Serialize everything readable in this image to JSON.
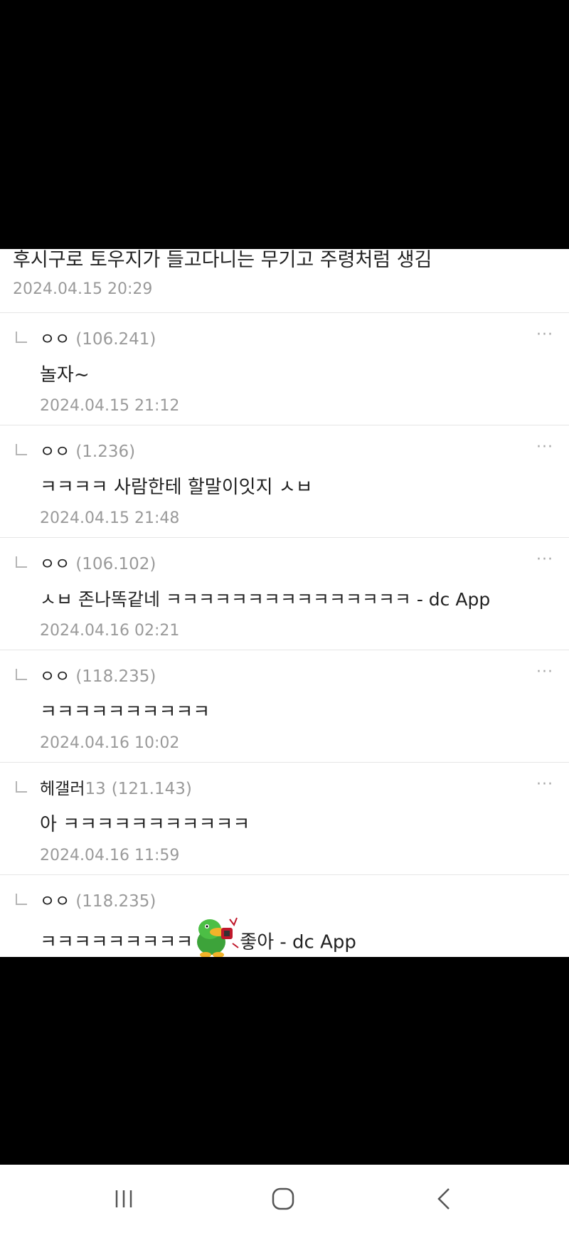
{
  "parent": {
    "text": "후시구로 토우지가 들고다니는 무기고 주령처럼 생김",
    "date": "2024.04.15 20:29"
  },
  "replies": [
    {
      "nick": "ㅇㅇ",
      "nick_num": "",
      "ip": "(106.241)",
      "text": "놀자~",
      "date": "2024.04.15 21:12"
    },
    {
      "nick": "ㅇㅇ",
      "nick_num": "",
      "ip": "(1.236)",
      "text": "ㅋㅋㅋㅋ 사람한테 할말이잇지 ㅅㅂ",
      "date": "2024.04.15 21:48"
    },
    {
      "nick": "ㅇㅇ",
      "nick_num": "",
      "ip": "(106.102)",
      "text": "ㅅㅂ 존나똑같네 ㅋㅋㅋㅋㅋㅋㅋㅋㅋㅋㅋㅋㅋㅋㅋ - dc App",
      "date": "2024.04.16 02:21"
    },
    {
      "nick": "ㅇㅇ",
      "nick_num": "",
      "ip": "(118.235)",
      "text": "ㅋㅋㅋㅋㅋㅋㅋㅋㅋㅋ",
      "date": "2024.04.16 10:02"
    },
    {
      "nick": "헤갤러",
      "nick_num": "13",
      "ip": "(121.143)",
      "text": "아 ㅋㅋㅋㅋㅋㅋㅋㅋㅋㅋㅋ",
      "date": "2024.04.16 11:59"
    },
    {
      "nick": "ㅇㅇ",
      "nick_num": "",
      "ip": "(118.235)",
      "text_before": "ㅋㅋㅋㅋㅋㅋㅋㅋㅋ",
      "text_after": "좋아 - dc App",
      "date": ""
    }
  ],
  "more_label": "···",
  "navbar": {
    "recent": "recent-apps-icon",
    "home": "home-icon",
    "back": "back-icon"
  }
}
